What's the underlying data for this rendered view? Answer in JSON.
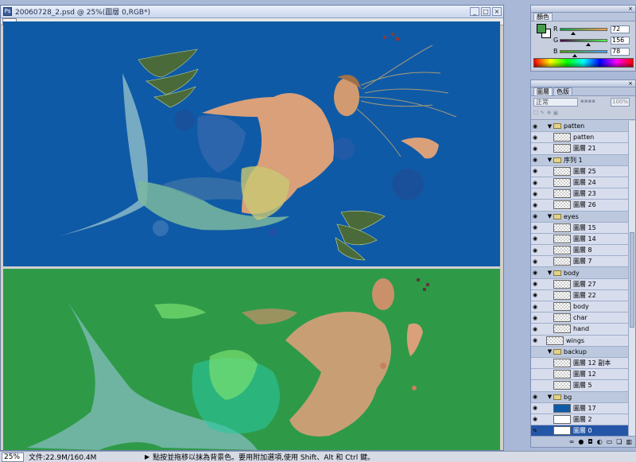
{
  "document": {
    "title": "20060728_2.psd @ 25%(圖層 0,RGB*)",
    "window_buttons": [
      "_",
      "□",
      "×"
    ]
  },
  "status": {
    "zoom": "25%",
    "doc_size": "文件:22.9M/160.4M",
    "hint": "點按並拖移以抹為背景色。要用附加選項,使用 Shift、Alt 和 Ctrl 鍵。"
  },
  "color_panel": {
    "tab": "顏色",
    "foreground_color": "#489c4e",
    "background_color": "#ffffff",
    "channels": [
      {
        "label": "R",
        "value": "72",
        "fraction": 0.28
      },
      {
        "label": "G",
        "value": "156",
        "fraction": 0.61
      },
      {
        "label": "B",
        "value": "78",
        "fraction": 0.31
      }
    ]
  },
  "layers_panel": {
    "tabs": [
      "圖層",
      "色版"
    ],
    "blend_mode": "正常",
    "opacity_value": "100%",
    "layers": [
      {
        "name": "patten",
        "type": "group",
        "eye": true,
        "expanded": true
      },
      {
        "name": "patten",
        "type": "layer",
        "eye": true,
        "thumb": "checker"
      },
      {
        "name": "圖層 21",
        "type": "layer",
        "eye": true,
        "thumb": "checker"
      },
      {
        "name": "序列 1",
        "type": "group",
        "eye": true,
        "expanded": true
      },
      {
        "name": "圖層 25",
        "type": "layer",
        "eye": true,
        "thumb": "checker"
      },
      {
        "name": "圖層 24",
        "type": "layer",
        "eye": true,
        "thumb": "checker"
      },
      {
        "name": "圖層 23",
        "type": "layer",
        "eye": true,
        "thumb": "checker"
      },
      {
        "name": "圖層 26",
        "type": "layer",
        "eye": true,
        "thumb": "checker"
      },
      {
        "name": "eyes",
        "type": "group",
        "eye": true,
        "expanded": true
      },
      {
        "name": "圖層 15",
        "type": "layer",
        "eye": true,
        "thumb": "checker"
      },
      {
        "name": "圖層 14",
        "type": "layer",
        "eye": true,
        "thumb": "checker"
      },
      {
        "name": "圖層 8",
        "type": "layer",
        "eye": true,
        "thumb": "checker"
      },
      {
        "name": "圖層 7",
        "type": "layer",
        "eye": true,
        "thumb": "checker"
      },
      {
        "name": "body",
        "type": "group",
        "eye": true,
        "expanded": true
      },
      {
        "name": "圖層 27",
        "type": "layer",
        "eye": true,
        "thumb": "checker"
      },
      {
        "name": "圖層 22",
        "type": "layer",
        "eye": true,
        "thumb": "checker"
      },
      {
        "name": "body",
        "type": "layer",
        "eye": true,
        "thumb": "checker"
      },
      {
        "name": "char",
        "type": "layer",
        "eye": true,
        "thumb": "checker"
      },
      {
        "name": "hand",
        "type": "layer",
        "eye": true,
        "thumb": "checker"
      },
      {
        "name": "wings",
        "type": "layer-top",
        "eye": true,
        "thumb": "checker"
      },
      {
        "name": "backup",
        "type": "group",
        "eye": false,
        "expanded": true
      },
      {
        "name": "圖層 12 副本",
        "type": "layer",
        "eye": false,
        "thumb": "checker"
      },
      {
        "name": "圖層 12",
        "type": "layer",
        "eye": false,
        "thumb": "checker"
      },
      {
        "name": "圖層 5",
        "type": "layer",
        "eye": false,
        "thumb": "checker"
      },
      {
        "name": "bg",
        "type": "group",
        "eye": true,
        "expanded": true
      },
      {
        "name": "圖層 17",
        "type": "layer",
        "eye": true,
        "thumb": "blue"
      },
      {
        "name": "圖層 2",
        "type": "layer",
        "eye": true,
        "thumb": "white"
      },
      {
        "name": "圖層 0",
        "type": "layer",
        "eye": false,
        "thumb": "white",
        "selected": true
      }
    ],
    "footer_icons": [
      "link-icon",
      "fx-icon",
      "mask-icon",
      "adjust-icon",
      "new-group-icon",
      "new-layer-icon",
      "trash-icon"
    ]
  }
}
